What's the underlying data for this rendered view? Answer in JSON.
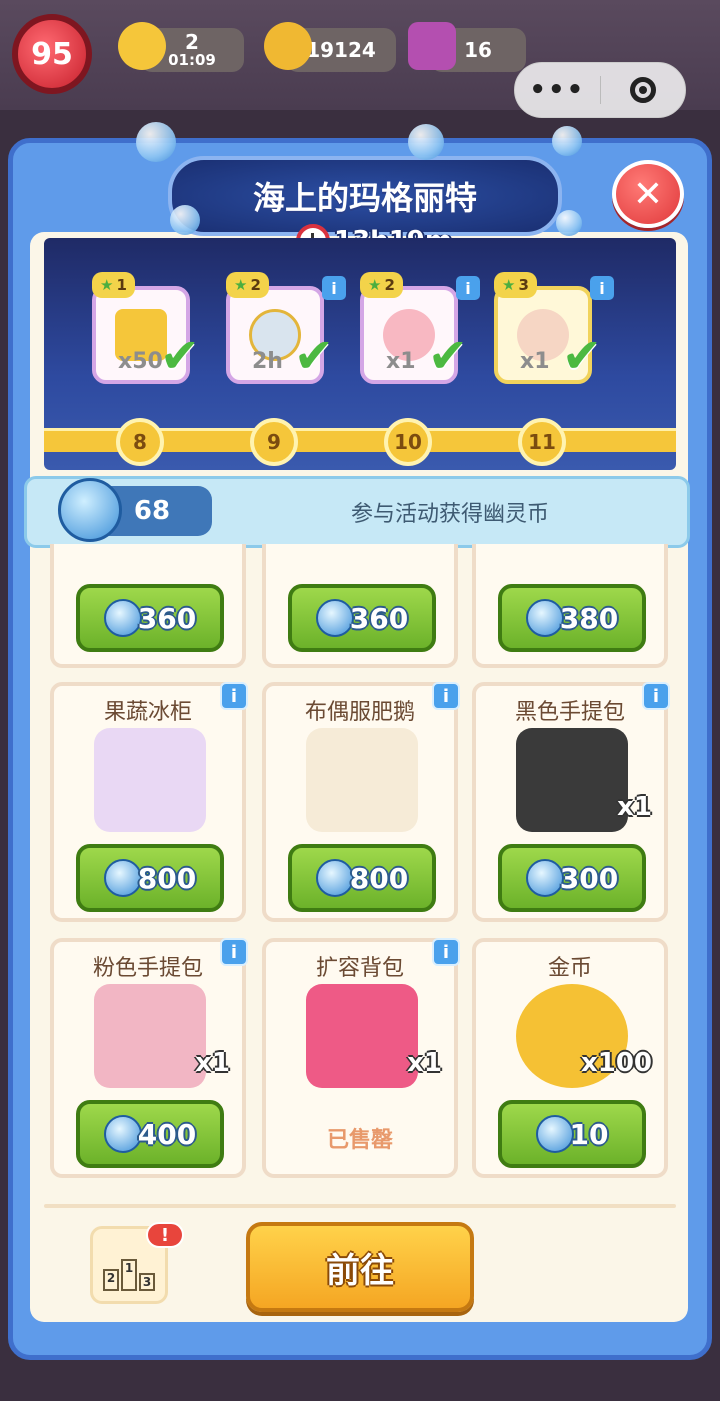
{
  "topbar": {
    "level": "95",
    "energy_count": "2",
    "energy_timer": "01:09",
    "gold": "19124",
    "gems": "16"
  },
  "event": {
    "title": "海上的玛格丽特",
    "timer": "13h19m"
  },
  "rewards": [
    {
      "stars": "1",
      "qty": "x50",
      "node": "8"
    },
    {
      "stars": "2",
      "qty": "2h",
      "node": "9"
    },
    {
      "stars": "2",
      "qty": "x1",
      "node": "10"
    },
    {
      "stars": "3",
      "qty": "x1",
      "node": "11"
    }
  ],
  "currency": {
    "count": "68",
    "hint": "参与活动获得幽灵币"
  },
  "shop": {
    "row1": [
      {
        "price": "360"
      },
      {
        "price": "360"
      },
      {
        "price": "380"
      }
    ],
    "row2": [
      {
        "name": "果蔬冰柜",
        "price": "800",
        "qty": ""
      },
      {
        "name": "布偶服肥鹅",
        "price": "800",
        "qty": ""
      },
      {
        "name": "黑色手提包",
        "price": "300",
        "qty": "x1"
      }
    ],
    "row3": [
      {
        "name": "粉色手提包",
        "price": "400",
        "qty": "x1"
      },
      {
        "name": "扩容背包",
        "status": "已售罄",
        "qty": "x1"
      },
      {
        "name": "金币",
        "price": "10",
        "qty": "x100"
      }
    ]
  },
  "footer": {
    "go_label": "前往",
    "rank_badge": "!"
  }
}
